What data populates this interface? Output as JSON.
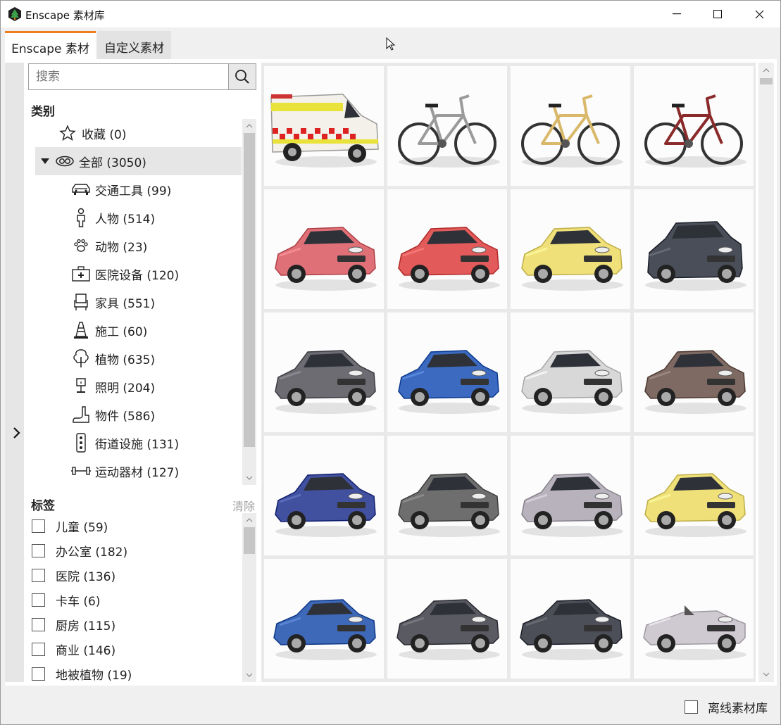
{
  "window": {
    "title": "Enscape 素材库"
  },
  "tabs": [
    {
      "label": "Enscape 素材",
      "active": true
    },
    {
      "label": "自定义素材",
      "active": false
    }
  ],
  "search": {
    "placeholder": "搜索"
  },
  "categories": {
    "title": "类别",
    "items": [
      {
        "label": "收藏 (0)",
        "icon": "star-icon"
      },
      {
        "label": "全部 (3050)",
        "icon": "rings-icon",
        "selected": true,
        "expanded": true
      },
      {
        "label": "交通工具 (99)",
        "icon": "car-icon"
      },
      {
        "label": "人物 (514)",
        "icon": "person-icon"
      },
      {
        "label": "动物 (23)",
        "icon": "paw-icon"
      },
      {
        "label": "医院设备 (120)",
        "icon": "medical-kit-icon"
      },
      {
        "label": "家具 (551)",
        "icon": "chair-icon"
      },
      {
        "label": "施工 (60)",
        "icon": "traffic-cone-icon"
      },
      {
        "label": "植物 (635)",
        "icon": "tree-icon"
      },
      {
        "label": "照明 (204)",
        "icon": "lamp-icon"
      },
      {
        "label": "物件 (586)",
        "icon": "object-icon"
      },
      {
        "label": "街道设施 (131)",
        "icon": "traffic-light-icon"
      },
      {
        "label": "运动器材 (127)",
        "icon": "dumbbell-icon"
      }
    ]
  },
  "tags": {
    "title": "标签",
    "clear_label": "清除",
    "items": [
      {
        "label": "儿童 (59)"
      },
      {
        "label": "办公室 (182)"
      },
      {
        "label": "医院 (136)"
      },
      {
        "label": "卡车 (6)"
      },
      {
        "label": "厨房 (115)"
      },
      {
        "label": "商业 (146)"
      },
      {
        "label": "地被植物 (19)"
      }
    ]
  },
  "assets": [
    {
      "kind": "ambulance",
      "color": "#f4f1ea"
    },
    {
      "kind": "bicycle",
      "color": "#9a9a9a"
    },
    {
      "kind": "bicycle",
      "color": "#d9b86a"
    },
    {
      "kind": "bicycle",
      "color": "#8a2a2a"
    },
    {
      "kind": "car",
      "color": "#e07078"
    },
    {
      "kind": "car",
      "color": "#e25a5a"
    },
    {
      "kind": "car",
      "color": "#f0e07a"
    },
    {
      "kind": "suv",
      "color": "#4a4e58"
    },
    {
      "kind": "car",
      "color": "#6c6c72"
    },
    {
      "kind": "car",
      "color": "#3b6ac0"
    },
    {
      "kind": "car",
      "color": "#d8d8d8"
    },
    {
      "kind": "car",
      "color": "#7e6a62"
    },
    {
      "kind": "car",
      "color": "#4250a0"
    },
    {
      "kind": "car",
      "color": "#6e6e6e"
    },
    {
      "kind": "car",
      "color": "#b8b2bc"
    },
    {
      "kind": "car",
      "color": "#efe07a"
    },
    {
      "kind": "sedan",
      "color": "#3e68b8"
    },
    {
      "kind": "sedan",
      "color": "#5a5a62"
    },
    {
      "kind": "sedan",
      "color": "#4c4e58"
    },
    {
      "kind": "convertible",
      "color": "#cfc9d2"
    }
  ],
  "footer": {
    "offline_label": "离线素材库"
  },
  "colors": {
    "accent": "#ee7d1c",
    "selected_bg": "#e6e6e6"
  }
}
